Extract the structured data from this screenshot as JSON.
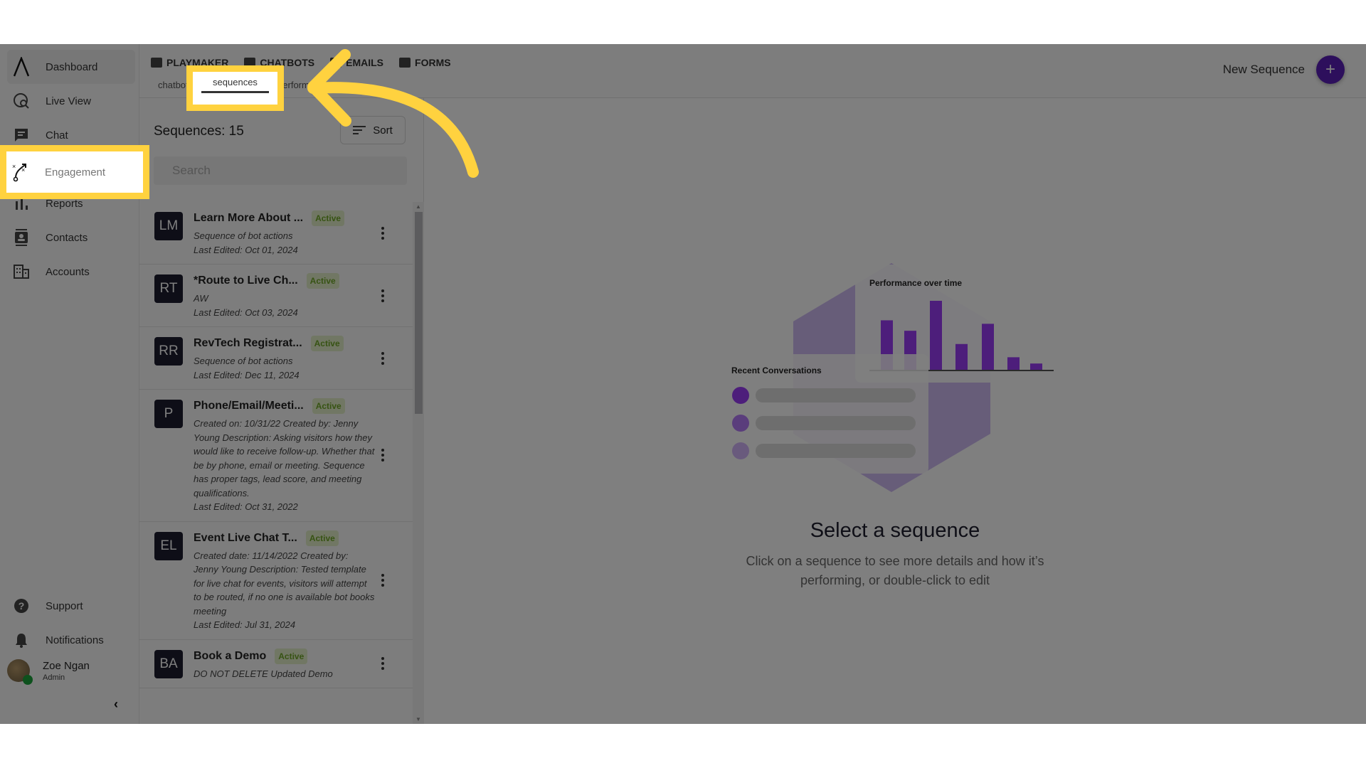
{
  "sidebar": {
    "items": [
      {
        "label": "Dashboard",
        "icon": "logo-caret-icon"
      },
      {
        "label": "Live View",
        "icon": "globe-search-icon"
      },
      {
        "label": "Chat",
        "icon": "chat-icon"
      },
      {
        "label": "Engagement",
        "icon": "playbook-icon"
      },
      {
        "label": "Reports",
        "icon": "bar-chart-icon"
      },
      {
        "label": "Contacts",
        "icon": "contact-card-icon"
      },
      {
        "label": "Accounts",
        "icon": "building-icon"
      }
    ],
    "bottom_items": [
      {
        "label": "Support",
        "icon": "help-circle-icon"
      },
      {
        "label": "Notifications",
        "icon": "bell-icon"
      }
    ],
    "user": {
      "name": "Zoe Ngan",
      "role": "Admin",
      "status_color": "#1aa33a"
    },
    "collapse_glyph": "‹"
  },
  "topbar": {
    "main_tabs": [
      {
        "label": "PLAYMAKER",
        "icon": "playmaker-icon"
      },
      {
        "label": "CHATBOTS",
        "icon": "chatbot-icon"
      },
      {
        "label": "EMAILS",
        "icon": "email-icon"
      },
      {
        "label": "FORMS",
        "icon": "form-check-icon"
      }
    ],
    "sub_tabs": [
      "chatbots",
      "sequences",
      "performance"
    ],
    "selected_sub_tab": "sequences",
    "new_sequence_label": "New Sequence",
    "new_sequence_glyph": "+"
  },
  "list": {
    "count_label": "Sequences: 15",
    "sort_label": "Sort",
    "search_placeholder": "Search",
    "items": [
      {
        "initials": "LM",
        "title": "Learn More About ...",
        "status": "Active",
        "desc": "Sequence of bot actions",
        "edited": "Last Edited: Oct 01, 2024"
      },
      {
        "initials": "RT",
        "title": "*Route to Live Ch...",
        "status": "Active",
        "desc": "AW",
        "edited": "Last Edited: Oct 03, 2024"
      },
      {
        "initials": "RR",
        "title": "RevTech Registrat...",
        "status": "Active",
        "desc": "Sequence of bot actions",
        "edited": "Last Edited: Dec 11, 2024"
      },
      {
        "initials": "P",
        "title": "Phone/Email/Meeti...",
        "status": "Active",
        "desc": "Created on: 10/31/22 Created by: Jenny Young Description: Asking visitors how they would like to receive follow-up. Whether that be by phone, email or meeting. Sequence has proper tags, lead score, and meeting qualifications.",
        "edited": "Last Edited: Oct 31, 2022"
      },
      {
        "initials": "EL",
        "title": "Event Live Chat T...",
        "status": "Active",
        "desc": "Created date: 11/14/2022 Created by: Jenny Young Description: Tested template for live chat for events, visitors will attempt to be routed, if no one is available bot books meeting",
        "edited": "Last Edited: Jul 31, 2024"
      },
      {
        "initials": "BA",
        "title": "Book a Demo",
        "status": "Active",
        "desc": "DO NOT DELETE Updated Demo",
        "edited": ""
      }
    ]
  },
  "empty_state": {
    "title": "Select a sequence",
    "subtitle": "Click on a sequence to see more details and how it’s performing, or double-click to edit",
    "illustration": {
      "chart_title": "Performance over time",
      "list_title": "Recent Conversations",
      "bar_values": [
        0.72,
        0.57,
        1.0,
        0.38,
        0.67,
        0.19,
        0.1
      ]
    }
  },
  "colors": {
    "accent": "#5a1fb8",
    "badge_bg": "#e2efc9",
    "badge_text": "#6ea626",
    "highlight": "#ffd23f",
    "tile": "#1c1d2e"
  }
}
